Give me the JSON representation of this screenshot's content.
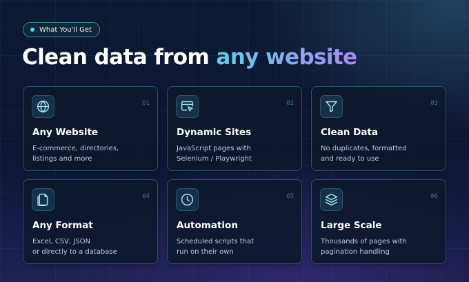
{
  "badge": {
    "label": "What You'll Get"
  },
  "headline": {
    "prefix": "Clean data from ",
    "accent": "any website"
  },
  "colors": {
    "accent_cyan": "#5fd3e6",
    "accent_violet": "#a78bf2",
    "card_border": "#2b5566"
  },
  "cards": [
    {
      "num": "01",
      "icon": "globe-icon",
      "title": "Any Website",
      "desc": [
        "E-commerce, directories,",
        "listings and more"
      ]
    },
    {
      "num": "02",
      "icon": "browser-cursor-icon",
      "title": "Dynamic Sites",
      "desc": [
        "JavaScript pages with",
        "Selenium / Playwright"
      ]
    },
    {
      "num": "03",
      "icon": "filter-icon",
      "title": "Clean Data",
      "desc": [
        "No duplicates, formatted",
        "and ready to use"
      ]
    },
    {
      "num": "04",
      "icon": "document-icon",
      "title": "Any Format",
      "desc": [
        "Excel, CSV, JSON",
        "or directly to a database"
      ]
    },
    {
      "num": "05",
      "icon": "clock-icon",
      "title": "Automation",
      "desc": [
        "Scheduled scripts that",
        "run on their own"
      ]
    },
    {
      "num": "06",
      "icon": "layers-icon",
      "title": "Large Scale",
      "desc": [
        "Thousands of pages with",
        "pagination handling"
      ]
    }
  ]
}
